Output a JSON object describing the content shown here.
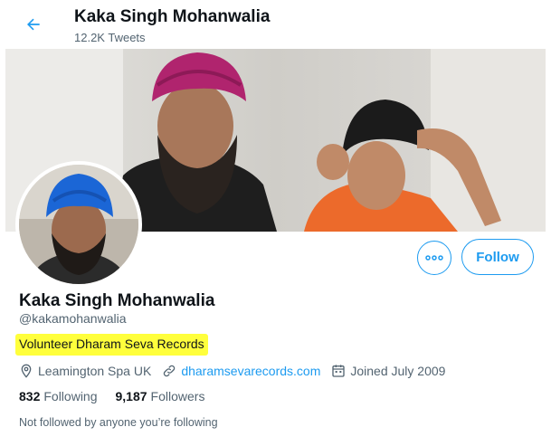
{
  "header": {
    "back_icon": "arrow-left-icon",
    "title": "Kaka Singh Mohanwalia",
    "tweet_count": "12.2K Tweets"
  },
  "profile": {
    "display_name": "Kaka Singh Mohanwalia",
    "handle": "@kakamohanwalia",
    "bio": "Volunteer Dharam Seva Records",
    "bio_highlight_color": "#ffff3c",
    "location": "Leamington Spa UK",
    "website": "dharamsevarecords.com",
    "joined": "Joined July 2009",
    "following_count": "832",
    "following_label": "Following",
    "followers_count": "9,187",
    "followers_label": "Followers",
    "followed_by_note": "Not followed by anyone you’re following"
  },
  "actions": {
    "more_icon": "more-horizontal-icon",
    "follow_label": "Follow"
  },
  "colors": {
    "accent": "#1d9bf0",
    "text_primary": "#0f1419",
    "text_secondary": "#536471"
  }
}
